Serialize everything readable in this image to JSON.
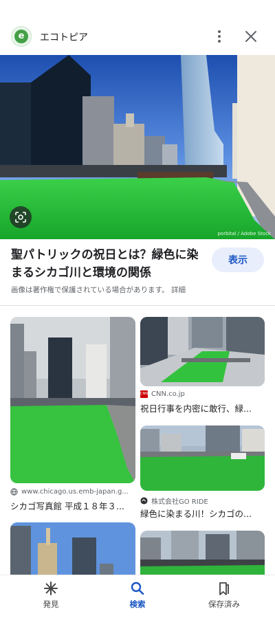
{
  "header": {
    "site_name": "エコトピア",
    "logo_letter": "e"
  },
  "hero": {
    "credit": "porbital / Adobe Stock"
  },
  "detail": {
    "title": "聖パトリックの祝日とは？緑色に染まるシカゴ川と環境の関係",
    "view_button": "表示",
    "notice": "画像は著作権で保護されている場合があります。 詳細"
  },
  "results": [
    {
      "source": "www.chicago.us.emb-japan.g...",
      "caption": "シカゴ写真館 平成１８年３...",
      "icon": "globe-icon"
    },
    {
      "source": "CNN.co.jp",
      "caption": "祝日行事を内密に敢行、緑...",
      "icon": "cnn-icon"
    },
    {
      "source": "株式会社GO RIDE",
      "caption": "緑色に染まる川！シカゴの...",
      "icon": "goride-icon"
    }
  ],
  "bottom_nav": {
    "items": [
      {
        "label": "発見",
        "icon": "asterisk-icon"
      },
      {
        "label": "検索",
        "icon": "search-icon"
      },
      {
        "label": "保存済み",
        "icon": "bookmark-icon"
      }
    ],
    "active": "検索"
  },
  "colors": {
    "accent": "#1a56c4",
    "river_green": "#2fbf3a"
  }
}
